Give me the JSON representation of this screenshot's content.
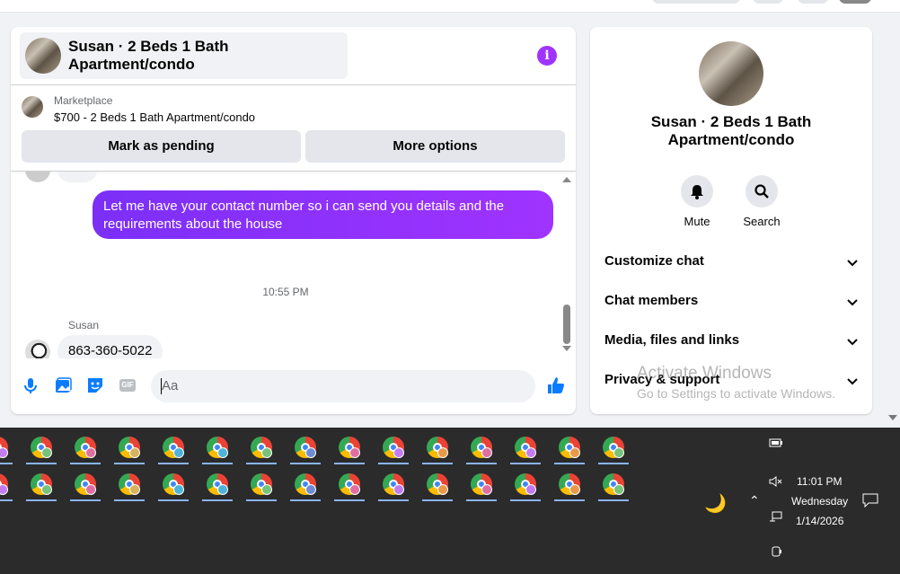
{
  "chat": {
    "header_title": "Susan · 2 Beds 1 Bath Apartment/condo",
    "marketplace_label": "Marketplace",
    "listing": "$700 - 2 Beds 1 Bath Apartment/condo",
    "mark_pending": "Mark as pending",
    "more_options": "More options",
    "messages": {
      "outgoing": "Let me have your contact number so i can send you details and the requirements about the house",
      "timestamp": "10:55 PM",
      "sender": "Susan",
      "incoming": "863-360-5022"
    },
    "composer": {
      "placeholder": "Aa",
      "icons": [
        "microphone-icon",
        "photo-icon",
        "sticker-icon",
        "gif-icon",
        "emoji-icon",
        "thumbs-up-icon"
      ],
      "gif_label": "GIF"
    }
  },
  "side": {
    "name": "Susan · 2 Beds 1 Bath Apartment/condo",
    "actions": [
      {
        "label": "Mute",
        "icon": "bell-icon"
      },
      {
        "label": "Search",
        "icon": "search-icon"
      }
    ],
    "sections": [
      "Customize chat",
      "Chat members",
      "Media, files and links",
      "Privacy & support"
    ]
  },
  "watermark": {
    "line1": "Activate Windows",
    "line2": "Go to Settings to activate Windows."
  },
  "taskbar": {
    "time": "11:01 PM",
    "day": "Wednesday",
    "date": "1/14/2026",
    "badge_colors": [
      "#c27cf0",
      "#78c27a",
      "#e06fa0",
      "#d6b35a",
      "#4fb3d9",
      "#4fb3d9",
      "#78c27a",
      "#6e8cd6",
      "#e06fa0",
      "#c27cf0",
      "#e89a4a",
      "#e06fa0",
      "#c27cf0",
      "#e89a4a",
      "#78c27a"
    ]
  },
  "colors": {
    "accent": "#0a7cff",
    "bubble_start": "#7b2ff7",
    "bubble_end": "#a033ff",
    "info": "#a033ff"
  }
}
